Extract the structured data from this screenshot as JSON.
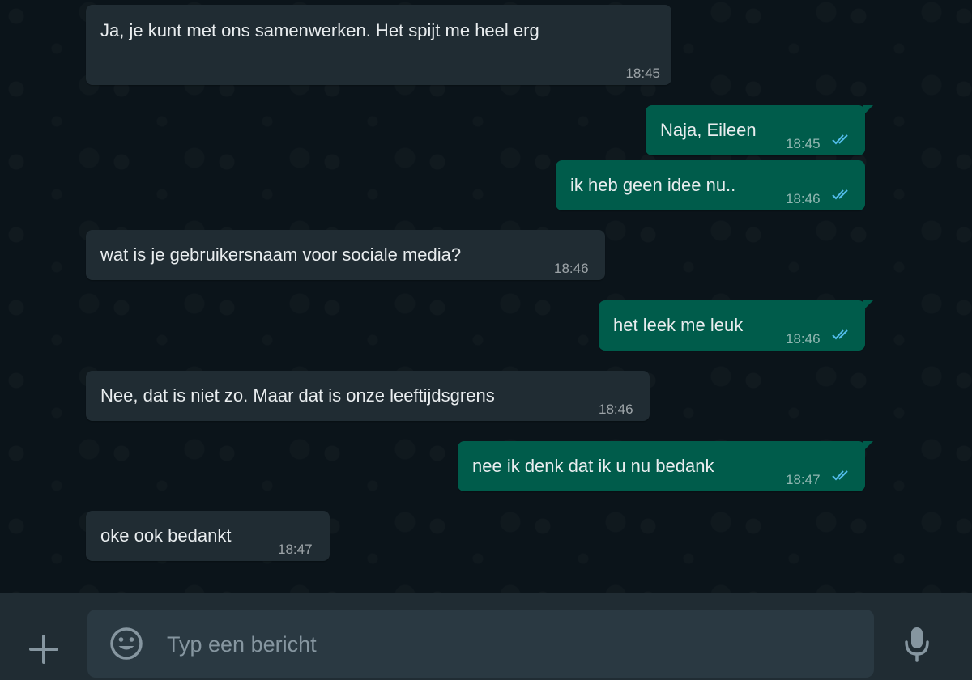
{
  "theme": {
    "incoming_bubble": "#202c33",
    "outgoing_bubble": "#005c4b",
    "read_tick_color": "#53bdeb",
    "chat_background": "#0b141a",
    "composer_background": "#202c33"
  },
  "messages": [
    {
      "direction": "incoming",
      "text": "Ja, je kunt met ons samenwerken. Het spijt me heel erg",
      "time": "18:45"
    },
    {
      "direction": "outgoing",
      "text": "Naja, Eileen",
      "time": "18:45",
      "status_icon": "double-check-read-icon"
    },
    {
      "direction": "outgoing",
      "text": "ik heb geen idee nu..",
      "time": "18:46",
      "status_icon": "double-check-read-icon"
    },
    {
      "direction": "incoming",
      "text": "wat is je gebruikersnaam voor sociale media?",
      "time": "18:46"
    },
    {
      "direction": "outgoing",
      "text": "het leek me leuk",
      "time": "18:46",
      "status_icon": "double-check-read-icon"
    },
    {
      "direction": "incoming",
      "text": "Nee, dat is niet zo. Maar dat is onze leeftijdsgrens",
      "time": "18:46"
    },
    {
      "direction": "outgoing",
      "text": "nee ik denk dat ik u nu bedank",
      "time": "18:47",
      "status_icon": "double-check-read-icon"
    },
    {
      "direction": "incoming",
      "text": "oke ook bedankt",
      "time": "18:47"
    }
  ],
  "composer": {
    "placeholder": "Typ een bericht",
    "value": "",
    "attach_icon": "plus-icon",
    "emoji_icon": "smiley-icon",
    "voice_icon": "microphone-icon"
  }
}
